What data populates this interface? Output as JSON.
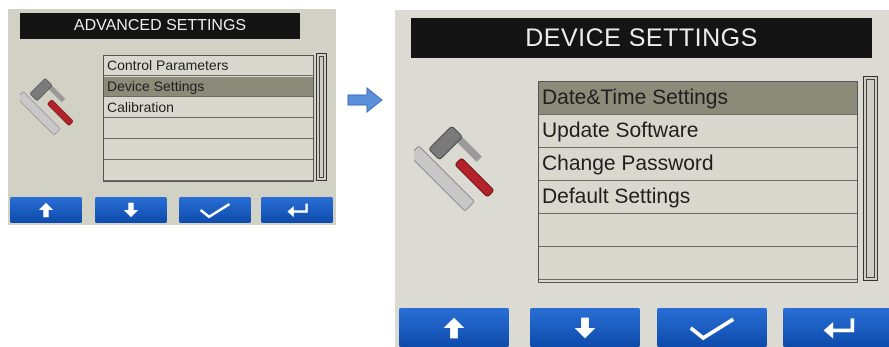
{
  "screens": {
    "advanced": {
      "title": "ADVANCED SETTINGS",
      "items": [
        {
          "label": "Control Parameters"
        },
        {
          "label": "Device Settings"
        },
        {
          "label": "Calibration"
        },
        {
          "label": ""
        },
        {
          "label": ""
        },
        {
          "label": ""
        }
      ],
      "selected_item": "Device Settings"
    },
    "device": {
      "title": "DEVICE SETTINGS",
      "items": [
        {
          "label": "Date&Time Settings"
        },
        {
          "label": "Update Software"
        },
        {
          "label": "Change Password"
        },
        {
          "label": "Default Settings"
        },
        {
          "label": ""
        },
        {
          "label": ""
        }
      ],
      "selected_item": "Date&Time Settings"
    }
  },
  "softkeys": [
    {
      "icon": "arrow-up-icon"
    },
    {
      "icon": "arrow-down-icon"
    },
    {
      "icon": "checkmark-icon"
    },
    {
      "icon": "return-icon"
    }
  ],
  "icons": {
    "tools": "hammer-screwdriver-icon",
    "transition": "right-arrow-icon"
  },
  "colors": {
    "title_bar": "#141414",
    "title_text": "#ececec",
    "selected_row": "#8c8a78",
    "softkey": "#1a5cc4",
    "screen_background": "#d9d8cf",
    "arrow": "#5b8fd9"
  }
}
